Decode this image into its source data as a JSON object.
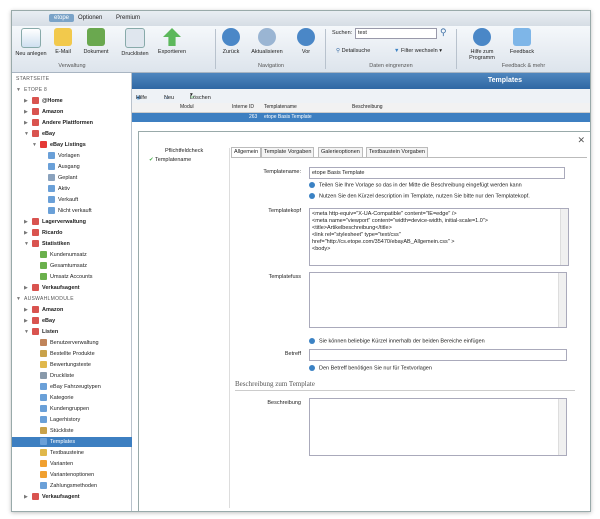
{
  "menu": {
    "items": [
      "etope",
      "Optionen",
      "Premium"
    ]
  },
  "ribbon": {
    "buttons": [
      "Neu anlegen",
      "E-Mail",
      "Dokument",
      "Drucklisten",
      "Exportieren",
      "Zurück",
      "Aktualisieren",
      "Vor",
      "Detailsuche",
      "Filter wechseln",
      "Hilfe zum Programm",
      "Feedback"
    ],
    "groups": [
      "Verwaltung",
      "Navigation",
      "Daten eingrenzen",
      "Feedback & mehr"
    ],
    "search_label": "Suchen:",
    "search_value": "test"
  },
  "sidebar": {
    "rows": [
      {
        "label": "STARTSEITE",
        "type": "hdr",
        "indent": 0
      },
      {
        "label": "ETOPE 8",
        "type": "hdr",
        "indent": 0,
        "expander": "▼"
      },
      {
        "label": "@Home",
        "type": "bold",
        "indent": 1,
        "expander": "▶",
        "icon": "home"
      },
      {
        "label": "Amazon",
        "type": "bold",
        "indent": 1,
        "expander": "▶",
        "icon": "home"
      },
      {
        "label": "Andere Plattformen",
        "type": "bold",
        "indent": 1,
        "expander": "▶",
        "icon": "home"
      },
      {
        "label": "eBay",
        "type": "bold",
        "indent": 1,
        "expander": "▼",
        "icon": "home"
      },
      {
        "label": "eBay Listings",
        "type": "bold",
        "indent": 2,
        "expander": "▼",
        "icon": "ebay"
      },
      {
        "label": "Vorlagen",
        "type": "normal",
        "indent": 3,
        "icon": "folder"
      },
      {
        "label": "Ausgang",
        "type": "normal",
        "indent": 3,
        "icon": "folder"
      },
      {
        "label": "Geplant",
        "type": "normal",
        "indent": 3,
        "icon": "clock"
      },
      {
        "label": "Aktiv",
        "type": "normal",
        "indent": 3,
        "icon": "folder"
      },
      {
        "label": "Verkauft",
        "type": "normal",
        "indent": 3,
        "icon": "folder"
      },
      {
        "label": "Nicht verkauft",
        "type": "normal",
        "indent": 3,
        "icon": "folder"
      },
      {
        "label": "Lagerverwaltung",
        "type": "bold",
        "indent": 1,
        "expander": "▶",
        "icon": "home"
      },
      {
        "label": "Ricardo",
        "type": "bold",
        "indent": 1,
        "expander": "▶",
        "icon": "home"
      },
      {
        "label": "Statistiken",
        "type": "bold",
        "indent": 1,
        "expander": "▼",
        "icon": "home"
      },
      {
        "label": "Kundenumsatz",
        "type": "normal",
        "indent": 2,
        "icon": "chart"
      },
      {
        "label": "Gesamtumsatz",
        "type": "normal",
        "indent": 2,
        "icon": "chart"
      },
      {
        "label": "Umsatz Accounts",
        "type": "normal",
        "indent": 2,
        "icon": "chart"
      },
      {
        "label": "Verkaufsagent",
        "type": "bold",
        "indent": 1,
        "expander": "▶",
        "icon": "home"
      },
      {
        "label": "AUSWAHLMODULE",
        "type": "hdr",
        "indent": 0,
        "expander": "▼"
      },
      {
        "label": "Amazon",
        "type": "bold",
        "indent": 1,
        "expander": "▶",
        "icon": "home"
      },
      {
        "label": "eBay",
        "type": "bold",
        "indent": 1,
        "expander": "▶",
        "icon": "home"
      },
      {
        "label": "Listen",
        "type": "bold",
        "indent": 1,
        "expander": "▼",
        "icon": "home"
      },
      {
        "label": "Benutzerverwaltung",
        "type": "normal",
        "indent": 2,
        "icon": "user"
      },
      {
        "label": "Bestellte Produkte",
        "type": "normal",
        "indent": 2,
        "icon": "box"
      },
      {
        "label": "Bewertungstexte",
        "type": "normal",
        "indent": 2,
        "icon": "note"
      },
      {
        "label": "Druckliste",
        "type": "normal",
        "indent": 2,
        "icon": "print"
      },
      {
        "label": "eBay Fahrzeugtypen",
        "type": "normal",
        "indent": 2,
        "icon": "folder"
      },
      {
        "label": "Kategorie",
        "type": "normal",
        "indent": 2,
        "icon": "folder"
      },
      {
        "label": "Kundengruppen",
        "type": "normal",
        "indent": 2,
        "icon": "folder"
      },
      {
        "label": "Lagerhistory",
        "type": "normal",
        "indent": 2,
        "icon": "folder"
      },
      {
        "label": "Stückliste",
        "type": "normal",
        "indent": 2,
        "icon": "box"
      },
      {
        "label": "Templates",
        "type": "sel",
        "indent": 2,
        "icon": "folder"
      },
      {
        "label": "Textbausteine",
        "type": "normal",
        "indent": 2,
        "icon": "note"
      },
      {
        "label": "Varianten",
        "type": "normal",
        "indent": 2,
        "icon": "tag"
      },
      {
        "label": "Variantenoptionen",
        "type": "normal",
        "indent": 2,
        "icon": "tag"
      },
      {
        "label": "Zahlungsmethoden",
        "type": "normal",
        "indent": 2,
        "icon": "folder"
      },
      {
        "label": "Verkaufsagent",
        "type": "bold",
        "indent": 1,
        "expander": "▶",
        "icon": "home"
      }
    ]
  },
  "main": {
    "title": "Templates",
    "toolbar": {
      "help": "Hilfe",
      "new": "Neu",
      "delete": "Löschen"
    },
    "table": {
      "headers": [
        "Modul",
        "Interne ID",
        "Templatename",
        "Beschreibung"
      ],
      "row": {
        "id": "263",
        "name": "etope Basis Template"
      }
    }
  },
  "dialog": {
    "left": {
      "title": "Pflichtfeldcheck",
      "item": "Templatename"
    },
    "tabs": [
      "Allgemein",
      "Template Vorgaben",
      "Galerieoptionen",
      "Textbaustein Vorgaben"
    ],
    "templatename_label": "Templatename:",
    "templatename_value": "etope Basis Template",
    "info1": "Teilen Sie Ihre Vorlage so das in der Mitte die Beschreibung eingefügt werden kann",
    "info2": "Nutzen Sie den Kürzel description im Template, nutzen Sie bitte nur den Templatekopf.",
    "templatekopf_label": "Templatekopf",
    "templatekopf_lines": [
      "<meta http-equiv=\"X-UA-Compatible\" content=\"IE=edge\" />",
      "<meta name=\"viewport\" content=\"width=device-width, initial-scale=1.0\">",
      "<title>Artikelbeschreibung</title>",
      "<link rel=\"stylesheet\" type=\"text/css\"",
      "href=\"http://cs.etope.com/35470/ebayAB_Allgemein.css\" >",
      "<body>"
    ],
    "templatefuss_label": "Templatefuss",
    "info3": "Sie können beliebige Kürzel innerhalb der beiden Bereiche einfügen",
    "betreff_label": "Betreff",
    "info4": "Den Betreff benötigen Sie nur für Textvorlagen",
    "section_title": "Beschreibung zum Template",
    "beschreibung_label": "Beschreibung"
  },
  "colors": {
    "accent": "#3d7fc1",
    "title_bar": "#2f67a3"
  }
}
